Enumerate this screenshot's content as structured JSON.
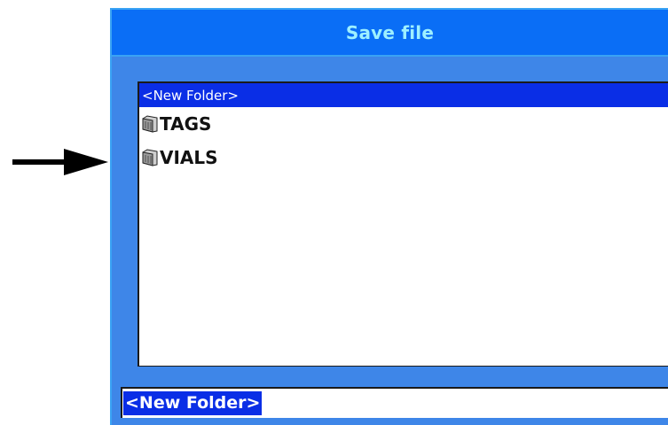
{
  "dialog": {
    "title": "Save file"
  },
  "file_list": {
    "items": [
      {
        "label": "<New Folder>",
        "type": "new-folder",
        "selected": true
      },
      {
        "label": "TAGS",
        "type": "folder",
        "icon": "folder-icon",
        "selected": false
      },
      {
        "label": "VIALS",
        "type": "folder",
        "icon": "folder-icon",
        "selected": false
      }
    ]
  },
  "name_field": {
    "value": "<New Folder>"
  },
  "colors": {
    "title_bar": "#0a6ef6",
    "title_text": "#9ef0ff",
    "dialog_body": "#3e86e8",
    "selection": "#0a2ee6"
  },
  "annotation": {
    "icon": "right-arrow-icon"
  }
}
